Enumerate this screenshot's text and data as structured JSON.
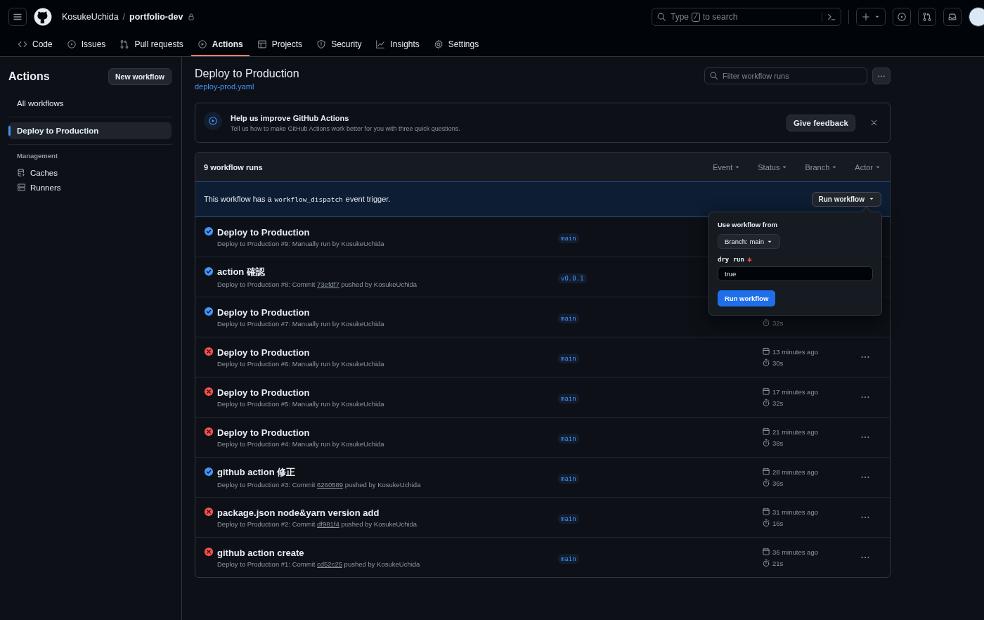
{
  "header": {
    "owner": "KosukeUchida",
    "separator": "/",
    "repo": "portfolio-dev",
    "private": true,
    "search": {
      "before": "Type",
      "key": "/",
      "after": "to search"
    }
  },
  "nav": [
    {
      "label": "Code",
      "selected": false
    },
    {
      "label": "Issues",
      "selected": false
    },
    {
      "label": "Pull requests",
      "selected": false
    },
    {
      "label": "Actions",
      "selected": true
    },
    {
      "label": "Projects",
      "selected": false
    },
    {
      "label": "Security",
      "selected": false
    },
    {
      "label": "Insights",
      "selected": false
    },
    {
      "label": "Settings",
      "selected": false
    }
  ],
  "sidebar": {
    "title": "Actions",
    "new_button": "New workflow",
    "items": [
      {
        "label": "All workflows",
        "selected": false
      },
      {
        "label": "Deploy to Production",
        "selected": true
      }
    ],
    "section": "Management",
    "management": [
      "Caches",
      "Runners"
    ]
  },
  "workflow": {
    "title": "Deploy to Production",
    "file": "deploy-prod.yaml",
    "filter": {
      "placeholder": "Filter workflow runs"
    }
  },
  "banner": {
    "title": "Help us improve GitHub Actions",
    "text": "Tell us how to make GitHub Actions work better for you with three quick questions.",
    "button": "Give feedback"
  },
  "runs": {
    "count": "9 workflow runs",
    "filters": [
      "Event",
      "Status",
      "Branch",
      "Actor"
    ],
    "dispatch": {
      "before": "This workflow has a",
      "code": "workflow_dispatch",
      "after": "event trigger.",
      "button": "Run workflow"
    },
    "items": [
      {
        "title": "Deploy to Production",
        "kind": "success",
        "description": "Deploy to Production #9: Manually run by KosukeUchida",
        "branch": "main"
      },
      {
        "title": "action 確認",
        "kind": "success",
        "description": "Deploy to Production #8: Commit",
        "commit": "73efdf7",
        "actor": "pushed by KosukeUchida",
        "branch": "v0.0.1"
      },
      {
        "title": "Deploy to Production",
        "kind": "success",
        "description": "Deploy to Production #7: Manually run by KosukeUchida",
        "branch": "main",
        "duration": "32s"
      },
      {
        "title": "Deploy to Production",
        "kind": "failure",
        "description": "Deploy to Production #6: Manually run by KosukeUchida",
        "branch": "main",
        "date": "13 minutes ago",
        "duration": "30s",
        "menu": true
      },
      {
        "title": "Deploy to Production",
        "kind": "failure",
        "description": "Deploy to Production #5: Manually run by KosukeUchida",
        "branch": "main",
        "date": "17 minutes ago",
        "duration": "32s",
        "menu": true
      },
      {
        "title": "Deploy to Production",
        "kind": "failure",
        "description": "Deploy to Production #4: Manually run by KosukeUchida",
        "branch": "main",
        "date": "21 minutes ago",
        "duration": "38s",
        "menu": true
      },
      {
        "title": "github action 修正",
        "kind": "success",
        "description": "Deploy to Production #3: Commit",
        "commit": "6260589",
        "actor": "pushed by KosukeUchida",
        "branch": "main",
        "date": "28 minutes ago",
        "duration": "36s",
        "menu": true
      },
      {
        "title": "package.json node&yarn version add",
        "kind": "failure",
        "description": "Deploy to Production #2: Commit",
        "commit": "df981f4",
        "actor": "pushed by KosukeUchida",
        "branch": "main",
        "date": "31 minutes ago",
        "duration": "16s",
        "menu": true
      },
      {
        "title": "github action create",
        "kind": "failure",
        "description": "Deploy to Production #1: Commit",
        "commit": "cd52c25",
        "actor": "pushed by KosukeUchida",
        "branch": "main",
        "date": "36 minutes ago",
        "duration": "21s",
        "menu": true
      }
    ]
  },
  "popup": {
    "heading": "Use workflow from",
    "branch_button": "Branch: main",
    "input_label": "dry run",
    "required": true,
    "value": "true",
    "submit": "Run workflow"
  }
}
